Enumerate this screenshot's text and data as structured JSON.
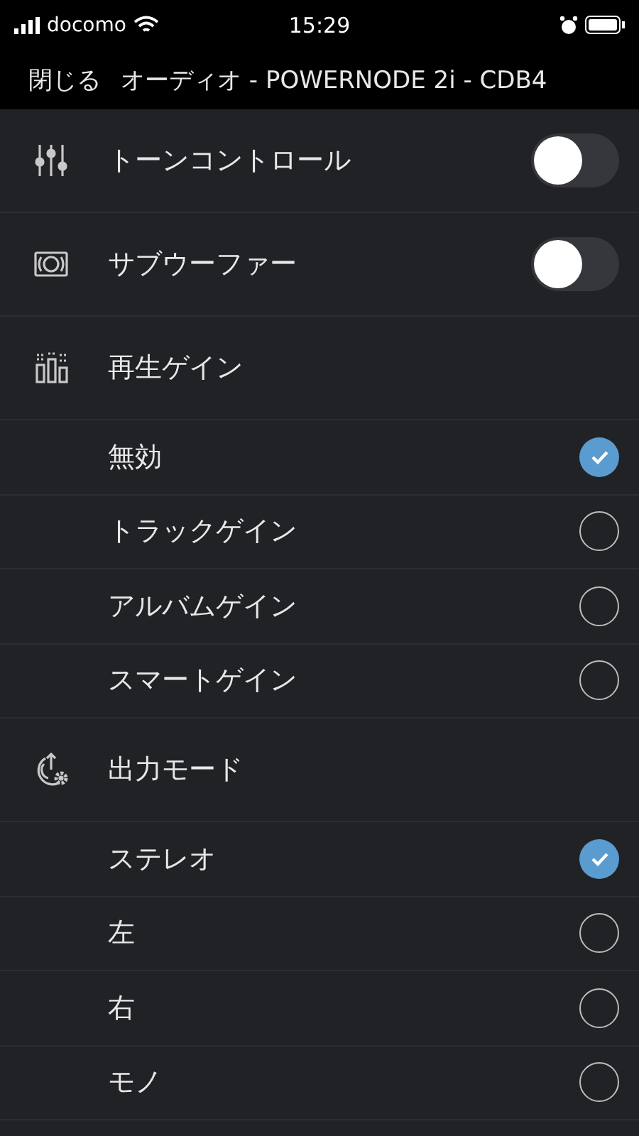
{
  "status_bar": {
    "carrier": "docomo",
    "time": "15:29"
  },
  "header": {
    "close": "閉じる",
    "title": "オーディオ - POWERNODE 2i - CDB4"
  },
  "toggles": [
    {
      "label": "トーンコントロール",
      "kind": "sliders",
      "on": false
    },
    {
      "label": "サブウーファー",
      "kind": "speaker",
      "on": false
    }
  ],
  "sections": [
    {
      "label": "再生ゲイン",
      "kind": "meters",
      "options": [
        {
          "label": "無効",
          "selected": true
        },
        {
          "label": "トラックゲイン",
          "selected": false
        },
        {
          "label": "アルバムゲイン",
          "selected": false
        },
        {
          "label": "スマートゲイン",
          "selected": false
        }
      ]
    },
    {
      "label": "出力モード",
      "kind": "output",
      "options": [
        {
          "label": "ステレオ",
          "selected": true
        },
        {
          "label": "左",
          "selected": false
        },
        {
          "label": "右",
          "selected": false
        },
        {
          "label": "モノ",
          "selected": false
        }
      ]
    }
  ]
}
